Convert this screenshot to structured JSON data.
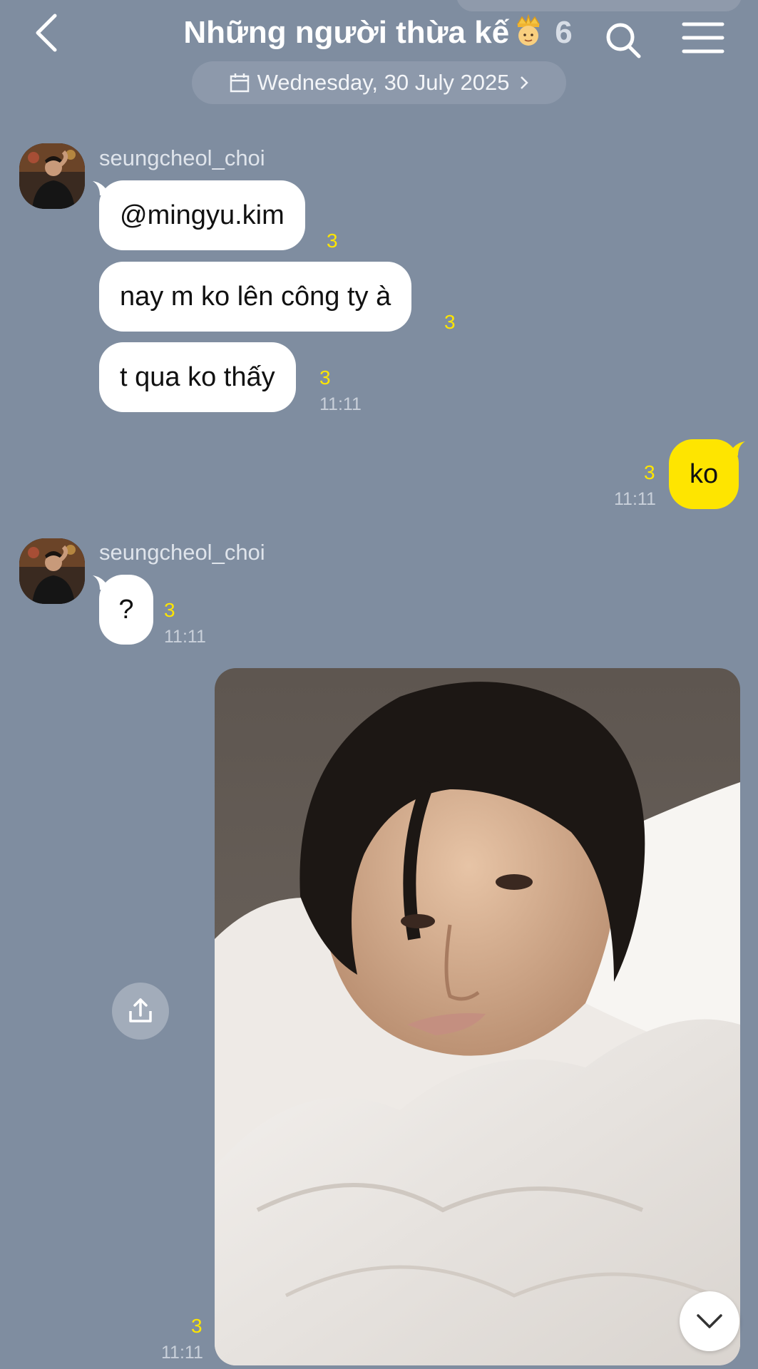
{
  "header": {
    "title": "Những người thừa kế",
    "member_count": "6",
    "back_icon": "chevron-left-icon",
    "search_icon": "search-icon",
    "menu_icon": "hamburger-menu-icon",
    "crown_icon": "crowned-person-emoji-icon"
  },
  "date_divider": {
    "label": "Wednesday, 30 July 2025",
    "icon": "calendar-icon"
  },
  "messages": [
    {
      "group": 1,
      "sender": "seungcheol_choi",
      "items": [
        {
          "text": "@mingyu.kim",
          "read": "3"
        },
        {
          "text": "nay m ko lên công ty à",
          "read": "3"
        },
        {
          "text": "t qua ko thấy",
          "read": "3",
          "time": "11:11"
        }
      ]
    },
    {
      "group": 2,
      "sender": "me",
      "items": [
        {
          "text": "ko",
          "read": "3",
          "time": "11:11"
        }
      ]
    },
    {
      "group": 3,
      "sender": "seungcheol_choi",
      "items": [
        {
          "text": "?",
          "read": "3",
          "time": "11:11"
        }
      ]
    },
    {
      "group": 4,
      "sender": "me",
      "items": [
        {
          "type": "photo",
          "read": "3",
          "time": "11:11"
        }
      ]
    }
  ],
  "controls": {
    "share_icon": "share-upload-icon",
    "scroll_down_icon": "chevron-down-icon"
  },
  "colors": {
    "background": "#7f8da0",
    "my_bubble": "#fee500",
    "their_bubble": "#ffffff",
    "read_count": "#fee500"
  }
}
